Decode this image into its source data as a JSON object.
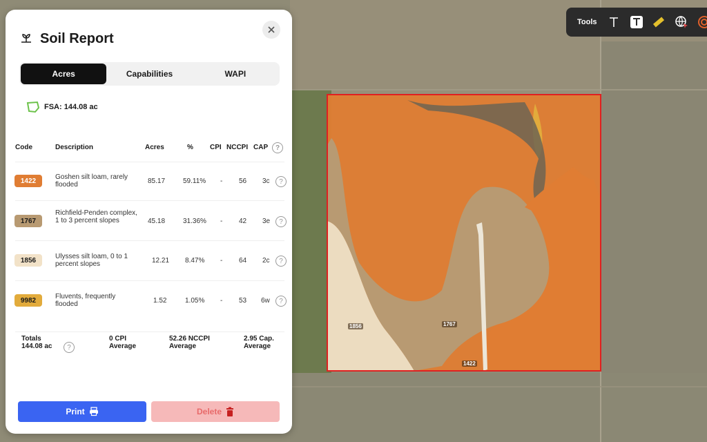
{
  "panel": {
    "title": "Soil Report",
    "tabs": [
      {
        "label": "Acres",
        "active": true
      },
      {
        "label": "Capabilities",
        "active": false
      },
      {
        "label": "WAPI",
        "active": false
      }
    ],
    "fsa_label": "FSA: 144.08 ac"
  },
  "table": {
    "headers": {
      "code": "Code",
      "description": "Description",
      "acres": "Acres",
      "percent": "%",
      "cpi": "CPI",
      "nccpi": "NCCPI",
      "cap": "CAP"
    },
    "rows": [
      {
        "code": "1422",
        "color": "#e07d33",
        "text_color": "#ffffff",
        "description": "Goshen silt loam, rarely flooded",
        "acres": "85.17",
        "percent": "59.11%",
        "cpi": "-",
        "nccpi": "56",
        "cap": "3c"
      },
      {
        "code": "1767",
        "color": "#b89a72",
        "text_color": "#1a1a1a",
        "description": "Richfield-Penden complex, 1 to 3 percent slopes",
        "acres": "45.18",
        "percent": "31.36%",
        "cpi": "-",
        "nccpi": "42",
        "cap": "3e"
      },
      {
        "code": "1856",
        "color": "#f2e2c8",
        "text_color": "#1a1a1a",
        "description": "Ulysses silt loam, 0 to 1 percent slopes",
        "acres": "12.21",
        "percent": "8.47%",
        "cpi": "-",
        "nccpi": "64",
        "cap": "2c"
      },
      {
        "code": "9982",
        "color": "#e2ab3c",
        "text_color": "#1a1a1a",
        "description": "Fluvents, frequently flooded",
        "acres": "1.52",
        "percent": "1.05%",
        "cpi": "-",
        "nccpi": "53",
        "cap": "6w"
      }
    ]
  },
  "totals": {
    "label": "Totals",
    "acres": "144.08 ac",
    "cpi_value": "0 CPI",
    "cpi_sub": "Average",
    "nccpi_value": "52.26 NCCPI",
    "nccpi_sub": "Average",
    "cap_value": "2.95 Cap.",
    "cap_sub": "Average"
  },
  "buttons": {
    "print": "Print",
    "delete": "Delete"
  },
  "tools": {
    "label": "Tools",
    "icons": [
      "text-outline-icon",
      "text-box-icon",
      "ruler-icon",
      "globe-pointer-icon",
      "target-ring-icon"
    ]
  },
  "map_labels": {
    "a": "1856",
    "b": "1767",
    "c": "1422"
  },
  "colors": {
    "accent_blue": "#3a64f2",
    "delete_bg": "#f6b9b9",
    "field_border": "#e02020"
  }
}
